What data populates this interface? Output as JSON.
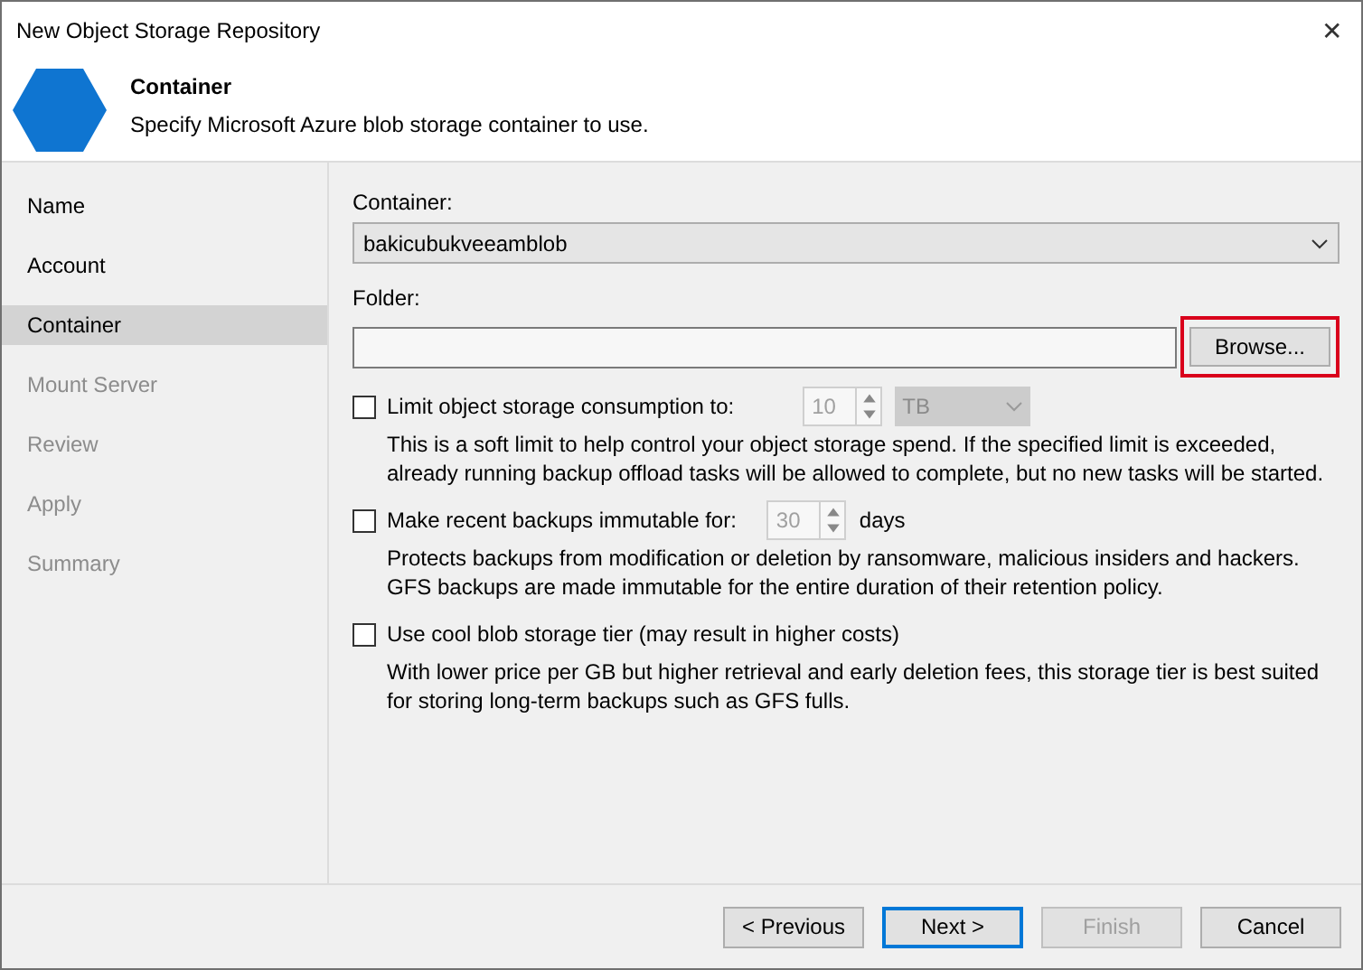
{
  "window": {
    "title": "New Object Storage Repository",
    "close": "✕"
  },
  "header": {
    "title": "Container",
    "subtitle": "Specify Microsoft Azure blob storage container to use."
  },
  "sidebar": {
    "items": [
      {
        "label": "Name",
        "selected": false,
        "disabled": false
      },
      {
        "label": "Account",
        "selected": false,
        "disabled": false
      },
      {
        "label": "Container",
        "selected": true,
        "disabled": false
      },
      {
        "label": "Mount Server",
        "selected": false,
        "disabled": true
      },
      {
        "label": "Review",
        "selected": false,
        "disabled": true
      },
      {
        "label": "Apply",
        "selected": false,
        "disabled": true
      },
      {
        "label": "Summary",
        "selected": false,
        "disabled": true
      }
    ]
  },
  "container": {
    "label": "Container:",
    "value": "bakicubukveeamblob"
  },
  "folder": {
    "label": "Folder:",
    "browse": {
      "label": "Browse...",
      "highlighted": true
    }
  },
  "options": [
    {
      "kind": "limit",
      "checked": false,
      "label": "Limit object storage consumption to:",
      "spin_value": "10",
      "unit": "TB",
      "description": "This is a soft limit to help control your object storage spend. If the specified limit is exceeded, already running backup offload tasks will be allowed to complete, but no new tasks will be started."
    },
    {
      "kind": "immutable",
      "checked": false,
      "label": "Make recent backups immutable for:",
      "spin_value": "30",
      "suffix": "days",
      "description": "Protects backups from modification or deletion by ransomware, malicious insiders and hackers. GFS backups are made immutable for the entire duration of their retention policy."
    },
    {
      "kind": "plain",
      "checked": false,
      "label": "Use cool blob storage tier (may result in higher costs)",
      "description": "With lower price per GB but higher retrieval and early deletion fees, this storage tier is best suited for storing long-term backups such as GFS fulls."
    }
  ],
  "buttons": [
    {
      "label": "< Previous",
      "default": false,
      "disabled": false
    },
    {
      "label": "Next >",
      "default": true,
      "disabled": false
    },
    {
      "label": "Finish",
      "default": false,
      "disabled": true
    },
    {
      "label": "Cancel",
      "default": false,
      "disabled": false
    }
  ]
}
